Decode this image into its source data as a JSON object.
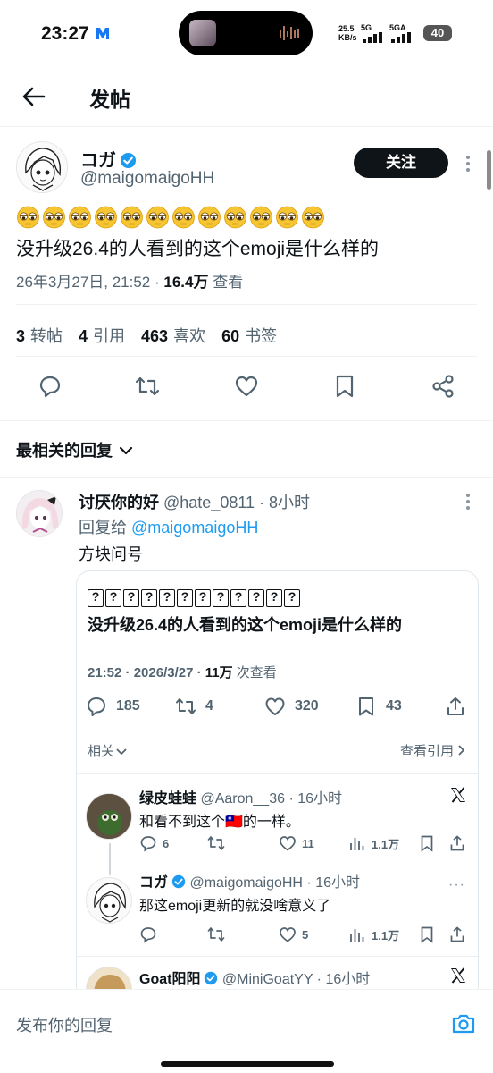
{
  "status_bar": {
    "time": "23:27",
    "net_speed_value": "25.5",
    "net_speed_unit": "KB/s",
    "sim1": "5G",
    "sim2": "5GA",
    "battery": "40"
  },
  "header": {
    "title": "发帖"
  },
  "post": {
    "author_name": "コガ",
    "author_handle": "@maigomaigoHH",
    "follow_label": "关注",
    "emoji_count": 12,
    "text": "没升级26.4的人看到的这个emoji是什么样的",
    "date": "26年3月27日, 21:52 · ",
    "views": "16.4万",
    "views_label": " 查看",
    "stats": {
      "reposts": "3",
      "reposts_label": "转帖",
      "quotes": "4",
      "quotes_label": "引用",
      "likes": "463",
      "likes_label": "喜欢",
      "bookmarks": "60",
      "bookmarks_label": "书签"
    }
  },
  "sort_label": "最相关的回复",
  "reply": {
    "name": "讨厌你的好",
    "handle": "@hate_0811 · 8小时",
    "reply_to_prefix": "回复给 ",
    "reply_to_handle": "@maigomaigoHH",
    "text": "方块问号"
  },
  "embed": {
    "box_count": 12,
    "text": "没升级26.4的人看到的这个emoji是什么样的",
    "meta_time": "21:52 · 2026/3/27 · ",
    "meta_views": "11万",
    "meta_views_label": " 次查看",
    "replies": "185",
    "reposts": "4",
    "likes": "320",
    "bookmarks": "43",
    "related_label": "相关",
    "quotes_label": "查看引用",
    "comments": [
      {
        "name": "绿皮蛙蛙",
        "handle": "@Aaron__36 · 16小时",
        "text": "和看不到这个🇹🇼的一样。",
        "replies": "6",
        "reposts": "",
        "likes": "11",
        "views": "1.1万"
      },
      {
        "name": "コガ",
        "handle": "@maigomaigoHH · 16小时",
        "text": "那这emoji更新的就没啥意义了",
        "replies": "",
        "reposts": "",
        "likes": "5",
        "views": "1.1万"
      },
      {
        "name": "Goat阳阳",
        "handle": "@MiniGoatYY · 16小时",
        "text": ""
      }
    ]
  },
  "composer": {
    "placeholder": "发布你的回复"
  },
  "colors": {
    "accent": "#1d9bf0",
    "text": "#0f1419",
    "muted": "#536471"
  }
}
